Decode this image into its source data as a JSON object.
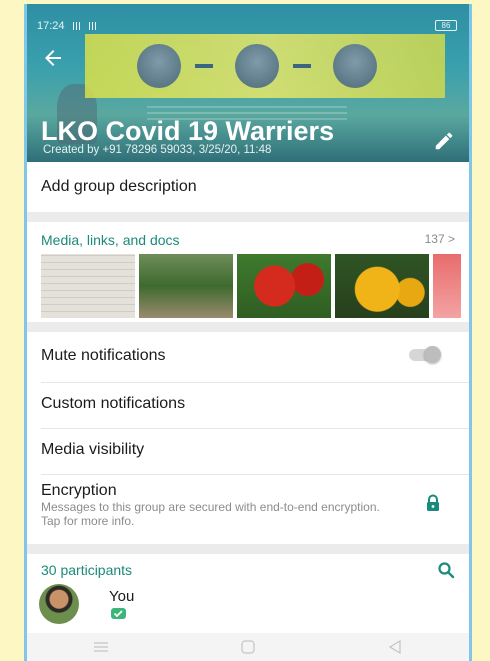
{
  "status_bar": {
    "time": "17:24",
    "battery": "86"
  },
  "header": {
    "group_name": "LKO Covid 19 Warriers",
    "created_by": "Created by +91 78296 59033, 3/25/20, 11:48"
  },
  "description": {
    "label": "Add group description"
  },
  "media": {
    "title": "Media, links, and docs",
    "count": "137 >"
  },
  "settings": {
    "mute": "Mute notifications",
    "custom": "Custom notifications",
    "visibility": "Media visibility",
    "encryption_title": "Encryption",
    "encryption_sub": "Messages to this group are secured with end-to-end encryption. Tap for more info."
  },
  "participants": {
    "title": "30 participants",
    "you": "You"
  },
  "colors": {
    "accent": "#1a8a7a",
    "badge": "#3cb57b"
  }
}
